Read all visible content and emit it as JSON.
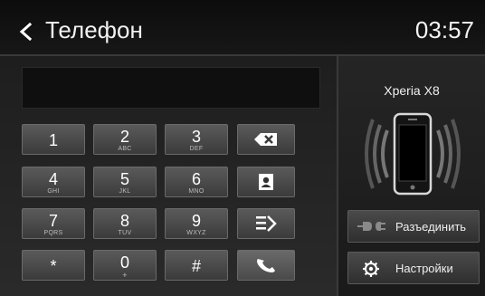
{
  "header": {
    "title": "Телефон",
    "clock": "03:57"
  },
  "dialer": {
    "display_value": "",
    "keys": [
      {
        "digit": "1",
        "letters": ""
      },
      {
        "digit": "2",
        "letters": "ABC"
      },
      {
        "digit": "3",
        "letters": "DEF"
      },
      {
        "digit": "4",
        "letters": "GHI"
      },
      {
        "digit": "5",
        "letters": "JKL"
      },
      {
        "digit": "6",
        "letters": "MNO"
      },
      {
        "digit": "7",
        "letters": "PQRS"
      },
      {
        "digit": "8",
        "letters": "TUV"
      },
      {
        "digit": "9",
        "letters": "WXYZ"
      },
      {
        "digit": "*",
        "letters": ""
      },
      {
        "digit": "0",
        "letters": "+"
      },
      {
        "digit": "#",
        "letters": ""
      }
    ],
    "function_icons": [
      "backspace-icon",
      "contacts-icon",
      "call-log-icon",
      "call-icon"
    ]
  },
  "device": {
    "name": "Xperia X8",
    "disconnect_label": "Разъединить",
    "settings_label": "Настройки"
  }
}
